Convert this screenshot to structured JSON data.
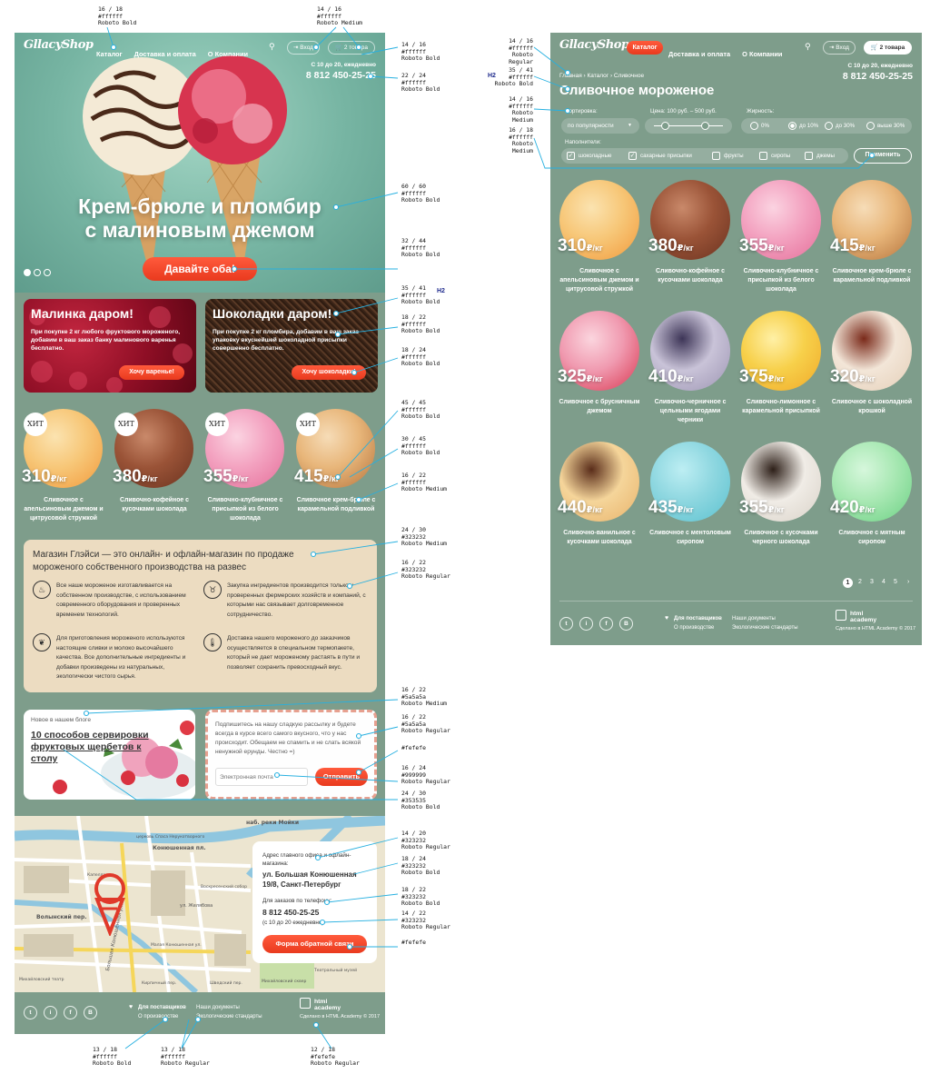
{
  "header": {
    "logo": "GllacyShop",
    "nav": [
      "Каталог",
      "Доставка и оплата",
      "О Компании"
    ],
    "login": "Вход",
    "cart": "2 товара",
    "hours": "С 10 до 20, ежедневно",
    "phone": "8 812 450-25-25"
  },
  "hero": {
    "title_line1": "Крем-брюле и пломбир",
    "title_line2": "с малиновым джемом",
    "cta": "Давайте оба!"
  },
  "promos": [
    {
      "title": "Малинка даром!",
      "text": "При покупке 2 кг любого фруктового мороженого, добавим в ваш заказ банку малинового варенья бесплатно.",
      "button": "Хочу варенье!"
    },
    {
      "title": "Шоколадки даром!",
      "text": "При покупке 2 кг пломбира, добавим в ваш заказ упаковку вкуснейшей шоколадной присыпки совершенно бесплатно.",
      "button": "Хочу шоколадки!"
    }
  ],
  "hit_label": "ХИТ",
  "price_unit": "₽/кг",
  "featured": [
    {
      "price": "310",
      "name": "Сливочное с апельсиновым джемом и цитрусовой стружкой"
    },
    {
      "price": "380",
      "name": "Сливочно-кофейное с кусочками шоколада"
    },
    {
      "price": "355",
      "name": "Сливочно-клубничное с присыпкой из белого шоколада"
    },
    {
      "price": "415",
      "name": "Сливочное крем-брюле с карамельной подливкой"
    }
  ],
  "about": {
    "title": "Магазин Глэйси — это онлайн- и офлайн-магазин по продаже мороженого собственного производства на развес",
    "items": [
      "Все наше мороженое изготавливается на собственном производстве, с использованием современного оборудования и проверенных временем технологий.",
      "Закупка ингредиентов производится только у проверенных фермерских хозяйств и компаний, с которыми нас связывает долговременное сотрудничество.",
      "Для приготовления мороженого используются настоящие сливки и молоко высочайшего качества. Все дополнительные ингредиенты и добавки произведены из натуральных, экологически чистого сырья.",
      "Доставка нашего мороженого до заказчиков осуществляется в специальном термопакете, который не дает мороженому растаять в пути и позволяет сохранить превосходный вкус."
    ]
  },
  "blog": {
    "label": "Новое в нашем блоге",
    "title": "10 способов сервировки фруктовых щербетов к столу"
  },
  "subscribe": {
    "text": "Подпишитесь на нашу сладкую рассылку и будете всегда в курсе всего самого вкусного, что у нас происходит. Обещаем не спамить и не слать всякой ненужной ерунды. Честно =)",
    "placeholder": "Электронная почта",
    "button": "Отправить"
  },
  "contacts": {
    "addr_label": "Адрес главного офиса и офлайн-магазина:",
    "address": "ул. Большая Конюшенная 19/8, Санкт-Петербург",
    "phone_label": "Для заказов по телефону:",
    "phone": "8 812 450-25-25",
    "hours": "(с 10 до 20 ежедневно)",
    "button": "Форма обратной связи"
  },
  "map": {
    "labels": [
      "церковь Спаса Нерукотворного",
      "Конюшенная пл.",
      "наб. реки Мойки",
      "Волынский пер.",
      "Большая Конюшенная ул.",
      "ул. Желябова",
      "Воскресенский собор",
      "Капелла",
      "Михайловский сквер",
      "Шведский пер.",
      "Кирпичный пер.",
      "Театральный музей",
      "Малая Конюшенная ул.",
      "Михайловский театр"
    ]
  },
  "footer": {
    "socials": [
      "t",
      "i",
      "f",
      "В"
    ],
    "suppliers": "Для поставщиков",
    "production": "О производстве",
    "documents": "Наши документы",
    "eco": "Экологические стандарты",
    "academy": "html academy",
    "made": "Сделано в HTML Academy © 2017"
  },
  "catalog": {
    "breadcrumbs": "Главная  ›  Каталог  ›  Сливочное",
    "title": "Сливочное мороженое",
    "sort_label": "Сортировка:",
    "sort_value": "по популярности",
    "price_label": "Цена: 100 руб. – 500 руб.",
    "fat_label": "Жирность:",
    "fat_options": [
      "0%",
      "до 10%",
      "до 30%",
      "выше 30%"
    ],
    "fat_selected": 1,
    "fillers_label": "Наполнители:",
    "fillers": [
      {
        "label": "шоколадные",
        "checked": true
      },
      {
        "label": "сахарные присыпки",
        "checked": true
      },
      {
        "label": "фрукты",
        "checked": false
      },
      {
        "label": "сиропы",
        "checked": false
      },
      {
        "label": "джемы",
        "checked": false
      }
    ],
    "apply": "Применить",
    "products": [
      {
        "price": "310",
        "name": "Сливочное с апельсиновым джемом и цитрусовой стружкой"
      },
      {
        "price": "380",
        "name": "Сливочно-кофейное с кусочками шоколада"
      },
      {
        "price": "355",
        "name": "Сливочно-клубничное с присыпкой из белого шоколада"
      },
      {
        "price": "415",
        "name": "Сливочное крем-брюле с карамельной подливкой"
      },
      {
        "price": "325",
        "name": "Сливочное с брусничным джемом"
      },
      {
        "price": "410",
        "name": "Сливочно-черничное с цельными ягодами черники"
      },
      {
        "price": "375",
        "name": "Сливочно-лимонное с карамельной присыпкой"
      },
      {
        "price": "320",
        "name": "Сливочное с шоколадной крошкой"
      },
      {
        "price": "440",
        "name": "Сливочно-ванильное с кусочками шоколада"
      },
      {
        "price": "435",
        "name": "Сливочное с ментоловым сиропом"
      },
      {
        "price": "355",
        "name": "Сливочное с кусочками черного шоколада"
      },
      {
        "price": "420",
        "name": "Сливочное с мятным сиропом"
      }
    ],
    "pages": [
      "1",
      "2",
      "3",
      "4",
      "5",
      "›"
    ]
  },
  "annotations": {
    "a1": "16 / 18\n#ffffff\nRoboto Bold",
    "a2": "14 / 16\n#ffffff\nRoboto Medium",
    "a3": "14 / 16\n#ffffff\nRoboto Bold",
    "a4": "22 / 24\n#ffffff\nRoboto Bold",
    "a5": "60 / 60\n#ffffff\nRoboto Bold",
    "a6": "32 / 44\n#ffffff\nRoboto Bold",
    "a7": "35 / 41\n#ffffff\nRoboto Bold",
    "a8": "18 / 22\n#ffffff\nRoboto Bold",
    "a9": "18 / 24\n#ffffff\nRoboto Bold",
    "a10": "45 / 45\n#ffffff\nRoboto Bold",
    "a11": "30 / 45\n#ffffff\nRoboto Bold",
    "a12": "16 / 22\n#ffffff\nRoboto Medium",
    "a13": "24 / 30\n#323232\nRoboto Medium",
    "a14": "16 / 22\n#323232\nRoboto Regular",
    "a15": "16 / 22\n#5a5a5a\nRoboto Medium",
    "a16": "16 / 22\n#5a5a5a\nRoboto Regular",
    "a17": "#fefefe",
    "a18": "16 / 24\n#999999\nRoboto Regular",
    "a19": "24 / 30\n#353535\nRoboto Bold",
    "a20": "14 / 20\n#323232\nRoboto Regular",
    "a21": "18 / 24\n#323232\nRoboto Bold",
    "a22": "18 / 22\n#323232\nRoboto Bold",
    "a23": "14 / 22\n#323232\nRoboto Regular",
    "a24": "#fefefe",
    "a25": "13 / 18\n#ffffff\nRoboto Bold",
    "a26": "13 / 18\n#ffffff\nRoboto Regular",
    "a27": "12 / 18\n#fefefe\nRoboto Regular",
    "r1": "14 / 16\n#ffffff\nRoboto Regular",
    "r2": "35 / 41\n#ffffff\nRoboto Bold",
    "r3": "14 / 16\n#ffffff\nRoboto Medium",
    "r4": "16 / 18\n#ffffff\nRoboto Medium",
    "h2": "H2"
  },
  "colors": {
    "bg": "#7e9d8b",
    "accent": "#ea4a2c",
    "dark_text": "#323232"
  }
}
